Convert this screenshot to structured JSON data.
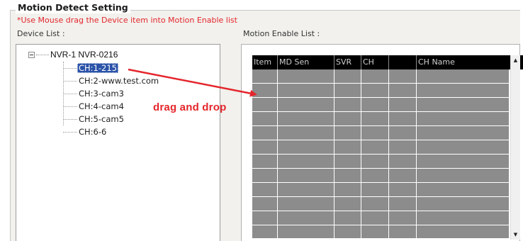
{
  "group": {
    "title": "Motion Detect Setting",
    "hint": "*Use Mouse drag the Device item into Motion Enable list"
  },
  "device_list": {
    "label": "Device List :",
    "root": {
      "label": "NVR-1 NVR-0216",
      "expanded": true
    },
    "items": [
      {
        "label": "CH:1-215",
        "selected": true
      },
      {
        "label": "CH:2-www.test.com",
        "selected": false
      },
      {
        "label": "CH:3-cam3",
        "selected": false
      },
      {
        "label": "CH:4-cam4",
        "selected": false
      },
      {
        "label": "CH:5-cam5",
        "selected": false
      },
      {
        "label": "CH:6-6",
        "selected": false
      }
    ]
  },
  "motion_list": {
    "label": "Motion Enable List :",
    "columns": [
      "Item",
      "MD Sen",
      "SVR",
      "CH",
      "",
      "CH Name"
    ],
    "row_count": 12,
    "scroll_up_icon": "triangle-up-icon",
    "scroll_down_icon": "triangle-down-icon"
  },
  "annotation": {
    "text": "drag and drop",
    "color": "#e4262c"
  },
  "colors": {
    "accent_red": "#e4262c",
    "selection_blue": "#2a52a8",
    "grid_gray": "#8c8c8c",
    "header_black": "#000000"
  }
}
